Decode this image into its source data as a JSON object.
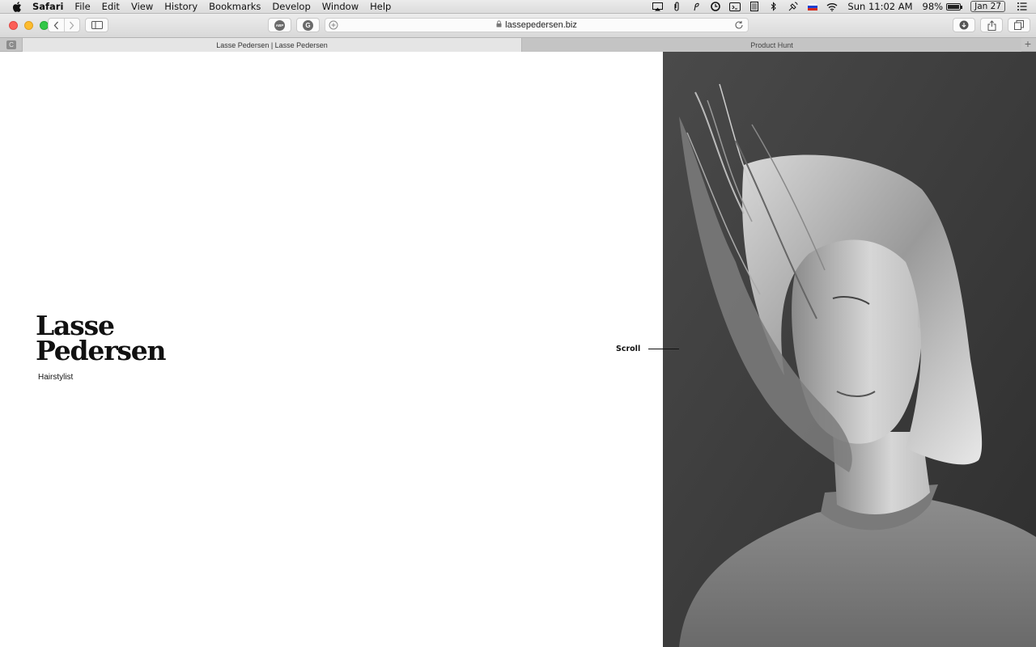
{
  "menubar": {
    "app_name": "Safari",
    "items": [
      "File",
      "Edit",
      "View",
      "History",
      "Bookmarks",
      "Develop",
      "Window",
      "Help"
    ],
    "clock": "Sun 11:02 AM",
    "battery_label": "98%",
    "battery_level": 0.98,
    "date_badge": "Jan 27"
  },
  "toolbar": {
    "url": "lassepedersen.biz",
    "extension_abp": "ABP",
    "extension_grammarly": "G"
  },
  "tabs": {
    "pinned_label": "C",
    "active_title": "Lasse Pedersen | Lasse Pedersen",
    "inactive_title": "Product Hunt",
    "new_tab_glyph": "+"
  },
  "page": {
    "brand_line1": "Lasse",
    "brand_line2": "Pedersen",
    "subtitle": "Hairstylist",
    "scroll_label": "Scroll"
  },
  "colors": {
    "accent_close": "#fc5f57",
    "accent_minimize": "#fdbc2e",
    "accent_maximize": "#33c748"
  }
}
